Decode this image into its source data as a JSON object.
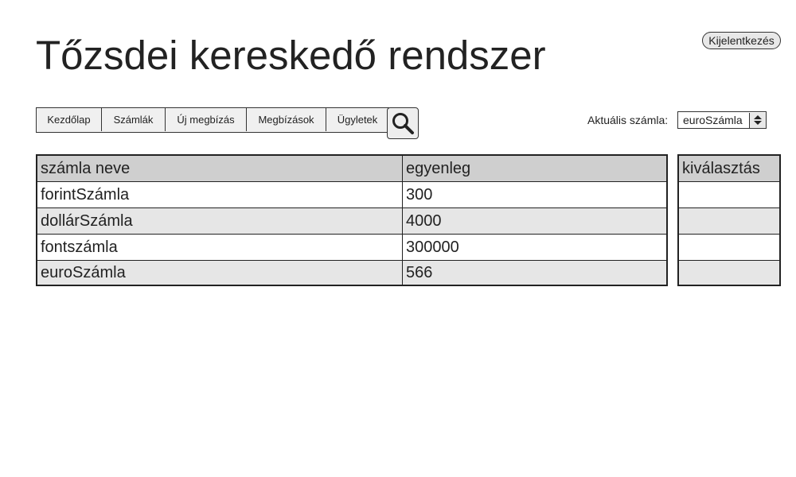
{
  "header": {
    "title": "Tőzsdei kereskedő rendszer",
    "logout_label": "Kijelentkezés"
  },
  "nav": {
    "items": [
      {
        "label": "Kezdőlap"
      },
      {
        "label": "Számlák"
      },
      {
        "label": "Új megbízás"
      },
      {
        "label": "Megbízások"
      },
      {
        "label": "Ügyletek"
      }
    ],
    "search_icon": "search-icon"
  },
  "account": {
    "label": "Aktuális számla:",
    "selected": "euroSzámla"
  },
  "accounts_table": {
    "columns": [
      "számla neve",
      "egyenleg"
    ],
    "rows": [
      {
        "name": "forintSzámla",
        "balance": "300"
      },
      {
        "name": "dollárSzámla",
        "balance": "4000"
      },
      {
        "name": "fontszámla",
        "balance": "300000"
      },
      {
        "name": "euroSzámla",
        "balance": "566"
      }
    ]
  },
  "selection": {
    "header": "kiválasztás"
  },
  "colors": {
    "header_bg": "#cfcfcf",
    "alt_row_bg": "#e6e6e6",
    "border": "#222222"
  }
}
